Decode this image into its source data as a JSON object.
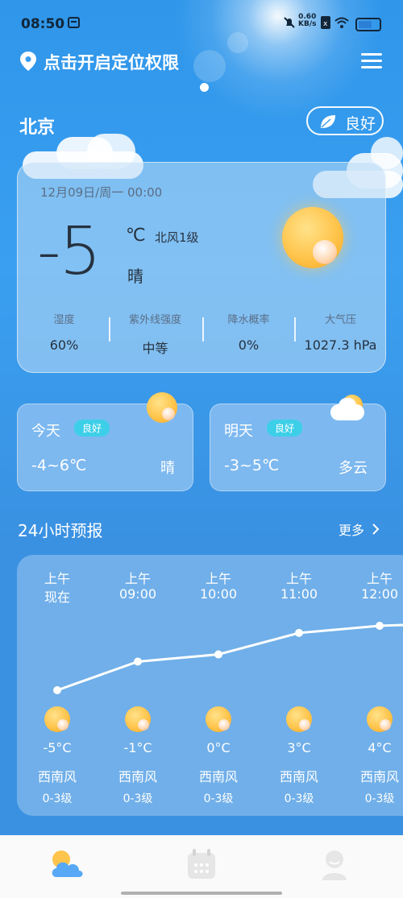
{
  "status_bar": {
    "time": "08:50",
    "net_speed_top": "0.60",
    "net_speed_bottom": "KB/s",
    "icons": [
      "notification-icon",
      "mute-icon",
      "sim-icon",
      "wifi-icon",
      "battery-icon"
    ]
  },
  "header": {
    "location_prompt": "点击开启定位权限",
    "menu_icon": "menu-icon"
  },
  "city": "北京",
  "aqi_button": {
    "label": "良好",
    "icon": "leaf-icon"
  },
  "current": {
    "datetime": "12月09日/周一 00:00",
    "temperature": "-5",
    "unit": "℃",
    "wind": "北风1级",
    "condition": "晴",
    "stats": [
      {
        "label": "湿度",
        "value": "60%"
      },
      {
        "label": "紫外线强度",
        "value": "中等"
      },
      {
        "label": "降水概率",
        "value": "0%"
      },
      {
        "label": "大气压",
        "value": "1027.3 hPa"
      }
    ]
  },
  "days": [
    {
      "name": "今天",
      "badge": "良好",
      "range": "-4~6℃",
      "condition": "晴",
      "icon": "sun-icon"
    },
    {
      "name": "明天",
      "badge": "良好",
      "range": "-3~5℃",
      "condition": "多云",
      "icon": "cloudy-icon"
    }
  ],
  "forecast": {
    "title": "24小时预报",
    "more_label": "更多",
    "hours": [
      {
        "ampm": "上午",
        "time": "现在",
        "temp": "-5°C",
        "temp_value": -5,
        "wind": "西南风",
        "level": "0-3级"
      },
      {
        "ampm": "上午",
        "time": "09:00",
        "temp": "-1°C",
        "temp_value": -1,
        "wind": "西南风",
        "level": "0-3级"
      },
      {
        "ampm": "上午",
        "time": "10:00",
        "temp": "0°C",
        "temp_value": 0,
        "wind": "西南风",
        "level": "0-3级"
      },
      {
        "ampm": "上午",
        "time": "11:00",
        "temp": "3°C",
        "temp_value": 3,
        "wind": "西南风",
        "level": "0-3级"
      },
      {
        "ampm": "上午",
        "time": "12:00",
        "temp": "4°C",
        "temp_value": 4,
        "wind": "西南风",
        "level": "0-3级"
      }
    ]
  },
  "bottom_nav": [
    {
      "name": "weather",
      "icon": "weather-icon",
      "active": true
    },
    {
      "name": "calendar",
      "icon": "calendar-icon",
      "active": false
    },
    {
      "name": "profile",
      "icon": "profile-icon",
      "active": false
    }
  ],
  "colors": {
    "accent": "#2f96ea",
    "badge": "#3ecfe8",
    "dark_text": "#26323f"
  }
}
